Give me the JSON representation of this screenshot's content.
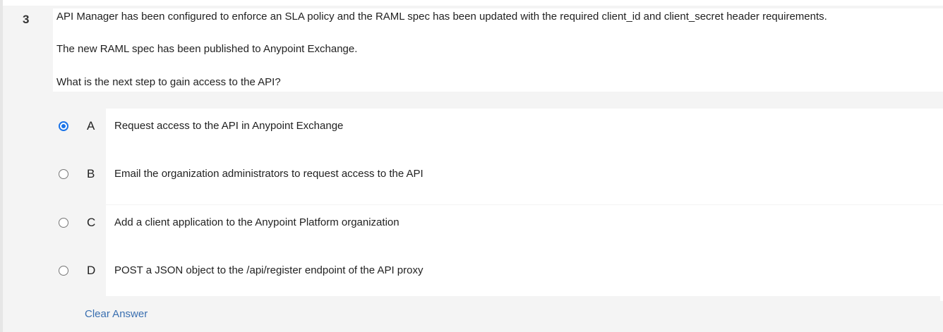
{
  "question": {
    "number": "3",
    "stem": [
      "API Manager has been configured to enforce an SLA policy and the RAML spec has been updated with the required client_id and client_secret header requirements.",
      "The new RAML spec has been published to Anypoint Exchange.",
      "What is the next step to gain access to the API?"
    ],
    "options": [
      {
        "letter": "A",
        "text": "Request access to the API in Anypoint Exchange",
        "selected": true
      },
      {
        "letter": "B",
        "text": "Email the organization administrators to request access to the API",
        "selected": false
      },
      {
        "letter": "C",
        "text": "Add a client application to the Anypoint Platform organization",
        "selected": false
      },
      {
        "letter": "D",
        "text": "POST a JSON object to the /api/register endpoint of the API proxy",
        "selected": false
      }
    ],
    "clear_label": "Clear Answer"
  },
  "colors": {
    "accent": "#1a73e8",
    "link": "#3a6fb0",
    "panel_gray": "#f4f4f4"
  }
}
